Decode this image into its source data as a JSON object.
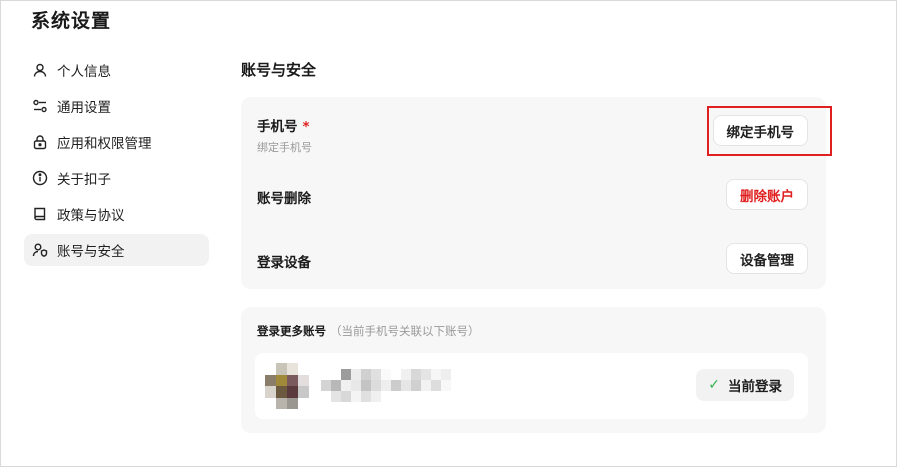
{
  "header": {
    "title": "系统设置"
  },
  "sidebar": {
    "items": [
      {
        "label": "个人信息",
        "icon": "user-icon"
      },
      {
        "label": "通用设置",
        "icon": "sliders-icon"
      },
      {
        "label": "应用和权限管理",
        "icon": "lock-icon"
      },
      {
        "label": "关于扣子",
        "icon": "info-icon"
      },
      {
        "label": "政策与协议",
        "icon": "book-icon"
      },
      {
        "label": "账号与安全",
        "icon": "user-shield-icon",
        "active": true
      }
    ]
  },
  "main": {
    "section_title": "账号与安全",
    "phone": {
      "label": "手机号",
      "required_mark": "*",
      "sub": "绑定手机号",
      "button": "绑定手机号"
    },
    "delete": {
      "label": "账号删除",
      "button": "删除账户"
    },
    "devices": {
      "label": "登录设备",
      "button": "设备管理"
    },
    "more_accounts": {
      "title": "登录更多账号",
      "hint": "（当前手机号关联以下账号）",
      "current_badge": "当前登录"
    }
  },
  "colors": {
    "danger": "#e02020",
    "success": "#2db34a",
    "card_bg": "#f7f7f7"
  }
}
